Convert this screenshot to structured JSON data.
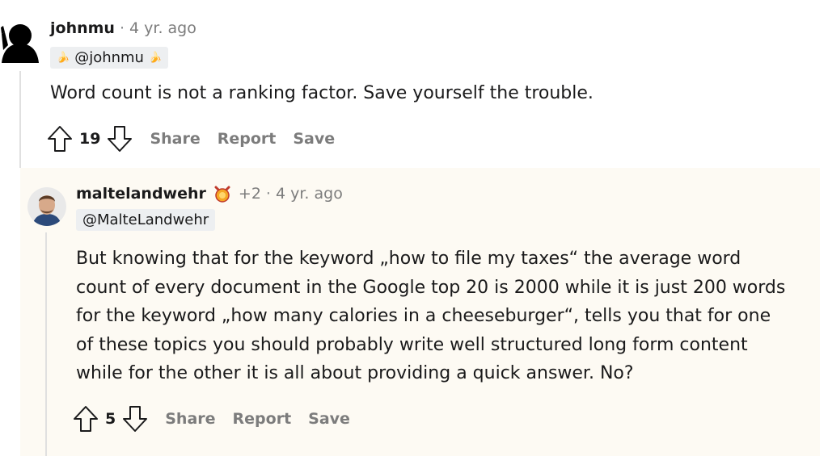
{
  "comments": [
    {
      "author": "johnmu",
      "time": "4 yr. ago",
      "flair": "@johnmu",
      "body": "Word count is not a ranking factor. Save yourself the trouble.",
      "score": "19",
      "actions": {
        "share": "Share",
        "report": "Report",
        "save": "Save"
      }
    },
    {
      "author": "maltelandwehr",
      "karma": "+2",
      "time": "4 yr. ago",
      "flair": "@MalteLandwehr",
      "body_lines": [
        "But knowing that for the keyword „how to file my taxes“ the average word",
        "count of every document in the Google top 20 is 2000 while it is just 200 words",
        "for the keyword „how many calories in a cheeseburger“, tells you that for one",
        "of these topics you should probably write well structured long form content",
        "while for the other it is all about providing a quick answer. No?"
      ],
      "score": "5",
      "actions": {
        "share": "Share",
        "report": "Report",
        "save": "Save"
      }
    }
  ],
  "icons": {
    "upvote": "arrow-up-outline-icon",
    "downvote": "arrow-down-outline-icon",
    "award": "award-icon",
    "flair_emoji": "banana-emoji-icon"
  },
  "colors": {
    "background": "#ffffff",
    "reply_background": "#fdfaf3",
    "text": "#1a1a1b",
    "muted": "#7c7c7c",
    "thread_line": "#e0e0e0",
    "flair_bg": "#edeff1"
  }
}
